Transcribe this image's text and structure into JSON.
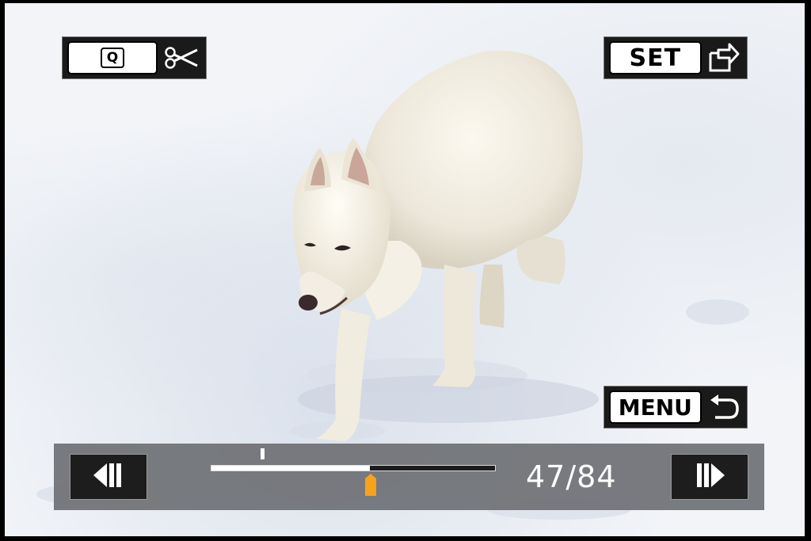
{
  "top_left_button": {
    "key_label": "Q",
    "icon": "scissors-icon"
  },
  "top_right_button": {
    "key_label": "SET",
    "icon": "export-box-icon"
  },
  "menu_button": {
    "key_label": "MENU",
    "icon": "return-arrow-icon"
  },
  "playback": {
    "current_frame": 47,
    "total_frames": 84,
    "counter_text": "47/84",
    "progress_fraction": 0.56,
    "cut_start_fraction": 0.18,
    "prev_icon": "step-back-icon",
    "next_icon": "step-forward-icon"
  },
  "colors": {
    "cursor": "#f7a21b",
    "bar": "#6e7074",
    "button": "#1a1a1a"
  }
}
